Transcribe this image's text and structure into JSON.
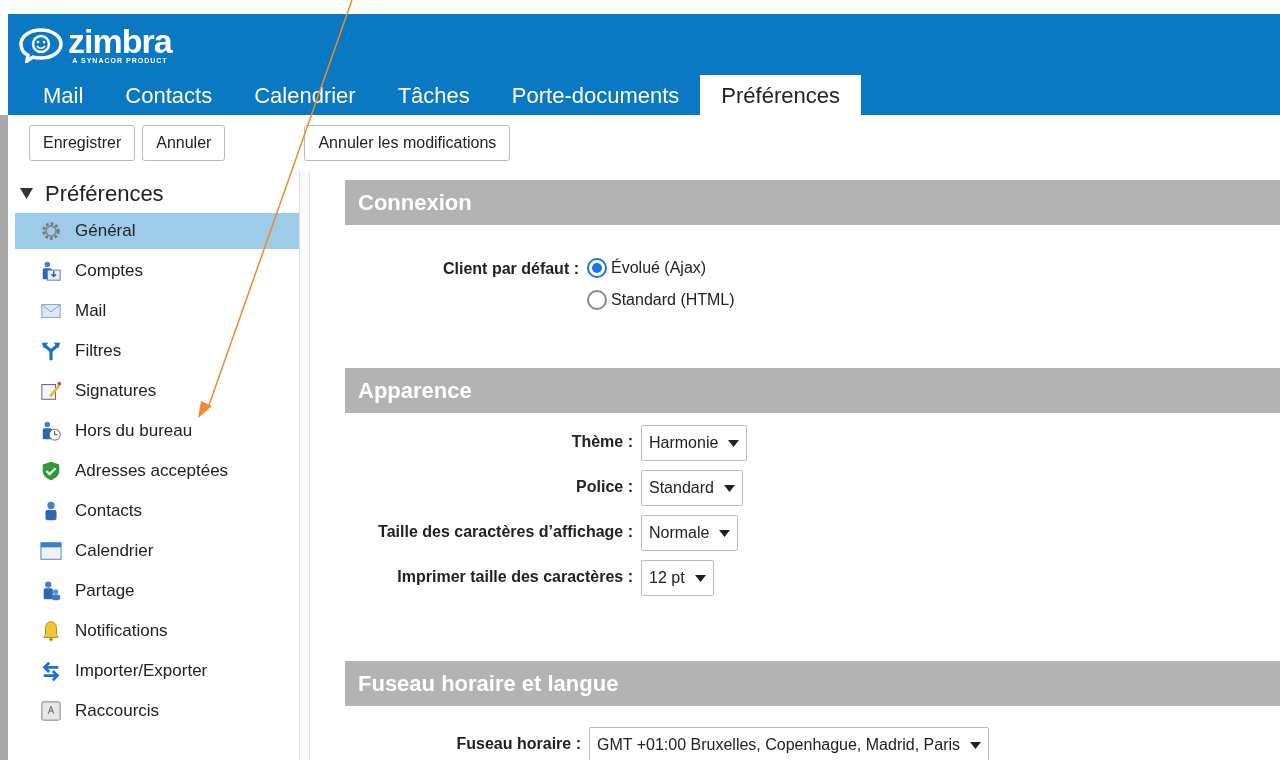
{
  "logo": {
    "name": "zimbra",
    "tagline": "A SYNACOR PRODUCT"
  },
  "tabs": [
    {
      "label": "Mail",
      "selected": false
    },
    {
      "label": "Contacts",
      "selected": false
    },
    {
      "label": "Calendrier",
      "selected": false
    },
    {
      "label": "Tâches",
      "selected": false
    },
    {
      "label": "Porte-documents",
      "selected": false
    },
    {
      "label": "Préférences",
      "selected": true
    }
  ],
  "toolbar": {
    "buttons": [
      "Enregistrer",
      "Annuler"
    ],
    "revert_button": "Annuler les modifications"
  },
  "sidebar": {
    "title": "Préférences",
    "expanded": true,
    "items": [
      {
        "label": "Général",
        "kind": "gear",
        "selected": true
      },
      {
        "label": "Comptes",
        "kind": "accounts",
        "selected": false
      },
      {
        "label": "Mail",
        "kind": "envelope",
        "selected": false
      },
      {
        "label": "Filtres",
        "kind": "filter",
        "selected": false
      },
      {
        "label": "Signatures",
        "kind": "signature",
        "selected": false
      },
      {
        "label": "Hors du bureau",
        "kind": "away",
        "selected": false
      },
      {
        "label": "Adresses acceptées",
        "kind": "shield",
        "selected": false
      },
      {
        "label": "Contacts",
        "kind": "person",
        "selected": false
      },
      {
        "label": "Calendrier",
        "kind": "calendar",
        "selected": false
      },
      {
        "label": "Partage",
        "kind": "sharing",
        "selected": false
      },
      {
        "label": "Notifications",
        "kind": "bell",
        "selected": false
      },
      {
        "label": "Importer/Exporter",
        "kind": "arrows",
        "selected": false
      },
      {
        "label": "Raccourcis",
        "kind": "key",
        "selected": false
      }
    ]
  },
  "sections": [
    {
      "title": "Connexion",
      "fields": [
        {
          "kind": "radio",
          "label": "Client par défaut :",
          "options": [
            {
              "label": "Évolué (Ajax)",
              "selected": true
            },
            {
              "label": "Standard (HTML)",
              "selected": false
            }
          ]
        }
      ]
    },
    {
      "title": "Apparence",
      "fields": [
        {
          "kind": "select",
          "label": "Thème :",
          "value": "Harmonie"
        },
        {
          "kind": "select",
          "label": "Police :",
          "value": "Standard"
        },
        {
          "kind": "select",
          "label": "Taille des caractères d’affichage :",
          "value": "Normale"
        },
        {
          "kind": "select",
          "label": "Imprimer taille des caractères :",
          "value": "12 pt"
        }
      ]
    },
    {
      "title": "Fuseau horaire et langue",
      "fields": [
        {
          "kind": "select",
          "label": "Fuseau horaire :",
          "value": "GMT +01:00 Bruxelles, Copenhague, Madrid, Paris"
        }
      ]
    }
  ]
}
